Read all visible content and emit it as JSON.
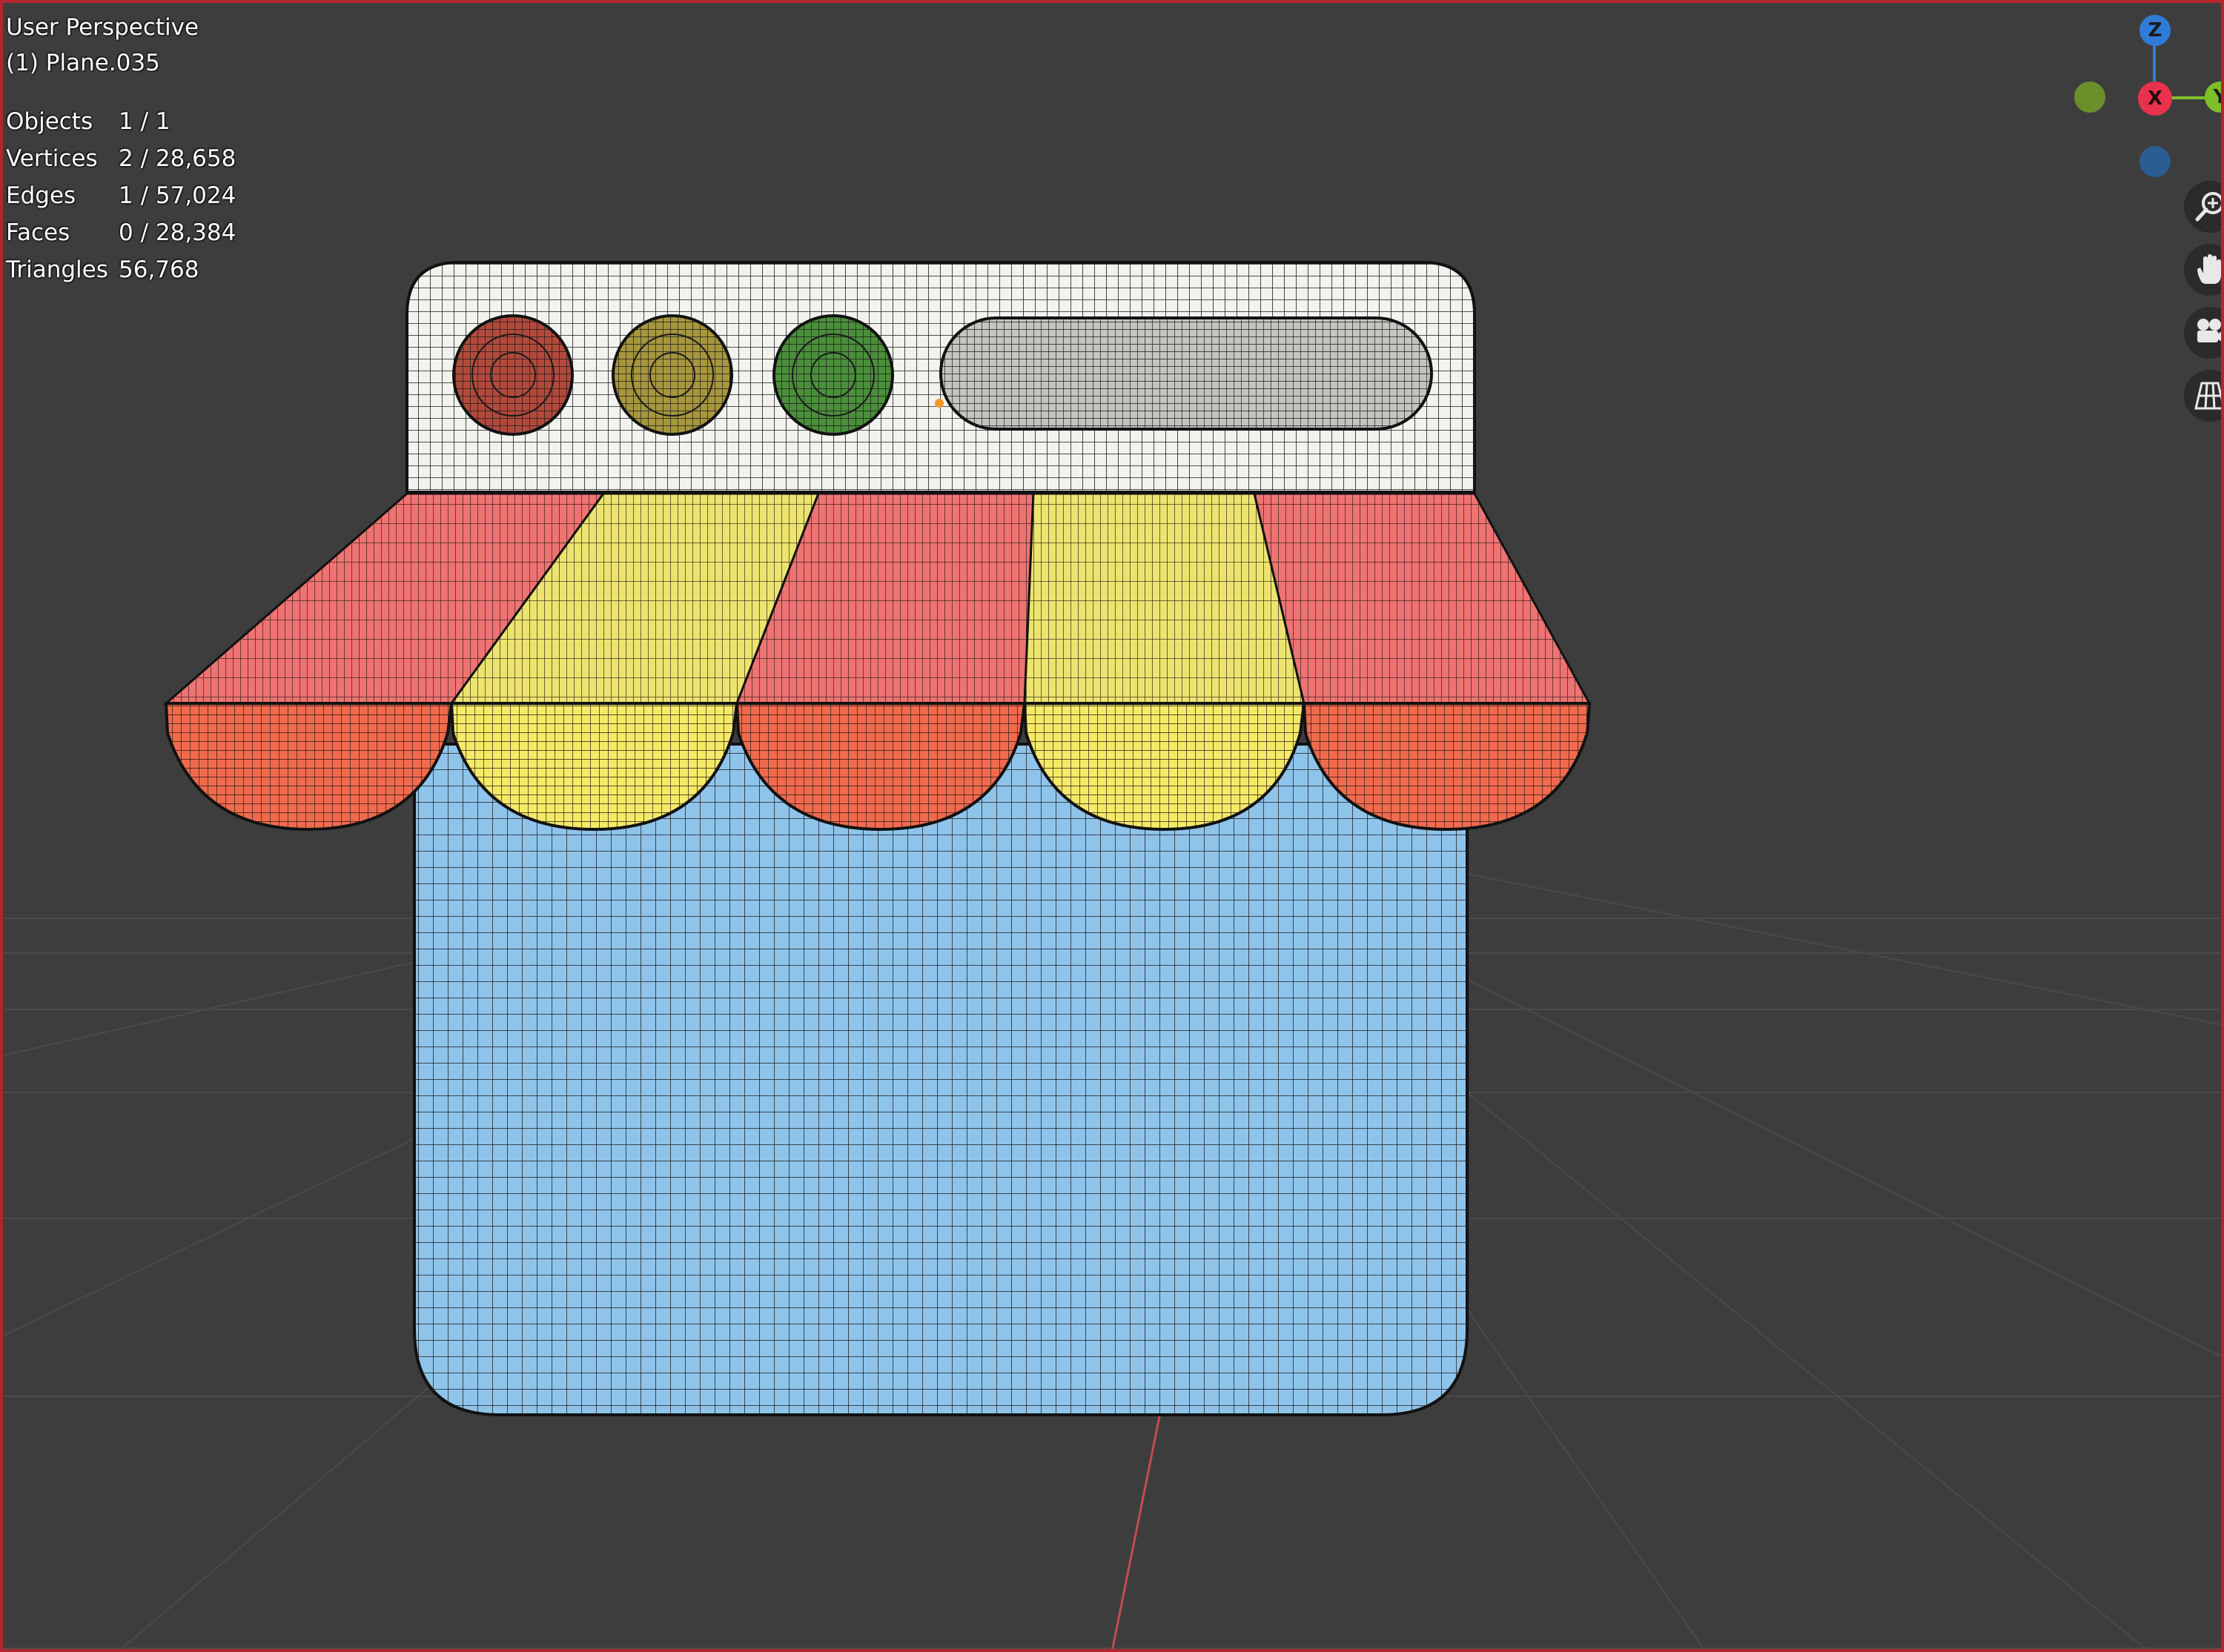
{
  "viewport": {
    "view_name": "User Perspective",
    "active_object": "(1) Plane.035"
  },
  "statistics": [
    {
      "label": "Objects",
      "value": "1 / 1"
    },
    {
      "label": "Vertices",
      "value": "2 / 28,658"
    },
    {
      "label": "Edges",
      "value": "1 / 57,024"
    },
    {
      "label": "Faces",
      "value": "0 / 28,384"
    },
    {
      "label": "Triangles",
      "value": "56,768"
    }
  ],
  "gizmo": {
    "z_label": "Z",
    "x_label": "X",
    "y_label": "Y",
    "colors": {
      "x": "#e8324d",
      "y": "#7fbf2a",
      "z": "#2f7cd8",
      "neg_y": "#6a8f2b",
      "neg_z": "#2b5c92"
    }
  },
  "nav_buttons": [
    {
      "name": "zoom-button",
      "icon": "magnifier-plus-icon"
    },
    {
      "name": "pan-button",
      "icon": "hand-icon"
    },
    {
      "name": "camera-view-button",
      "icon": "camera-icon"
    },
    {
      "name": "perspective-toggle-button",
      "icon": "grid-icon"
    }
  ],
  "model_colors": {
    "sign_board": "#f2f2ee",
    "light_red": "#b24a3c",
    "light_yellow": "#a6963d",
    "light_green": "#4a8f3a",
    "awning_red": "#f06a4e",
    "awning_red_top": "#ee7372",
    "awning_yellow": "#f4ea68",
    "awning_yellow_top": "#ece46f",
    "body_blue": "#8fc4ea"
  }
}
